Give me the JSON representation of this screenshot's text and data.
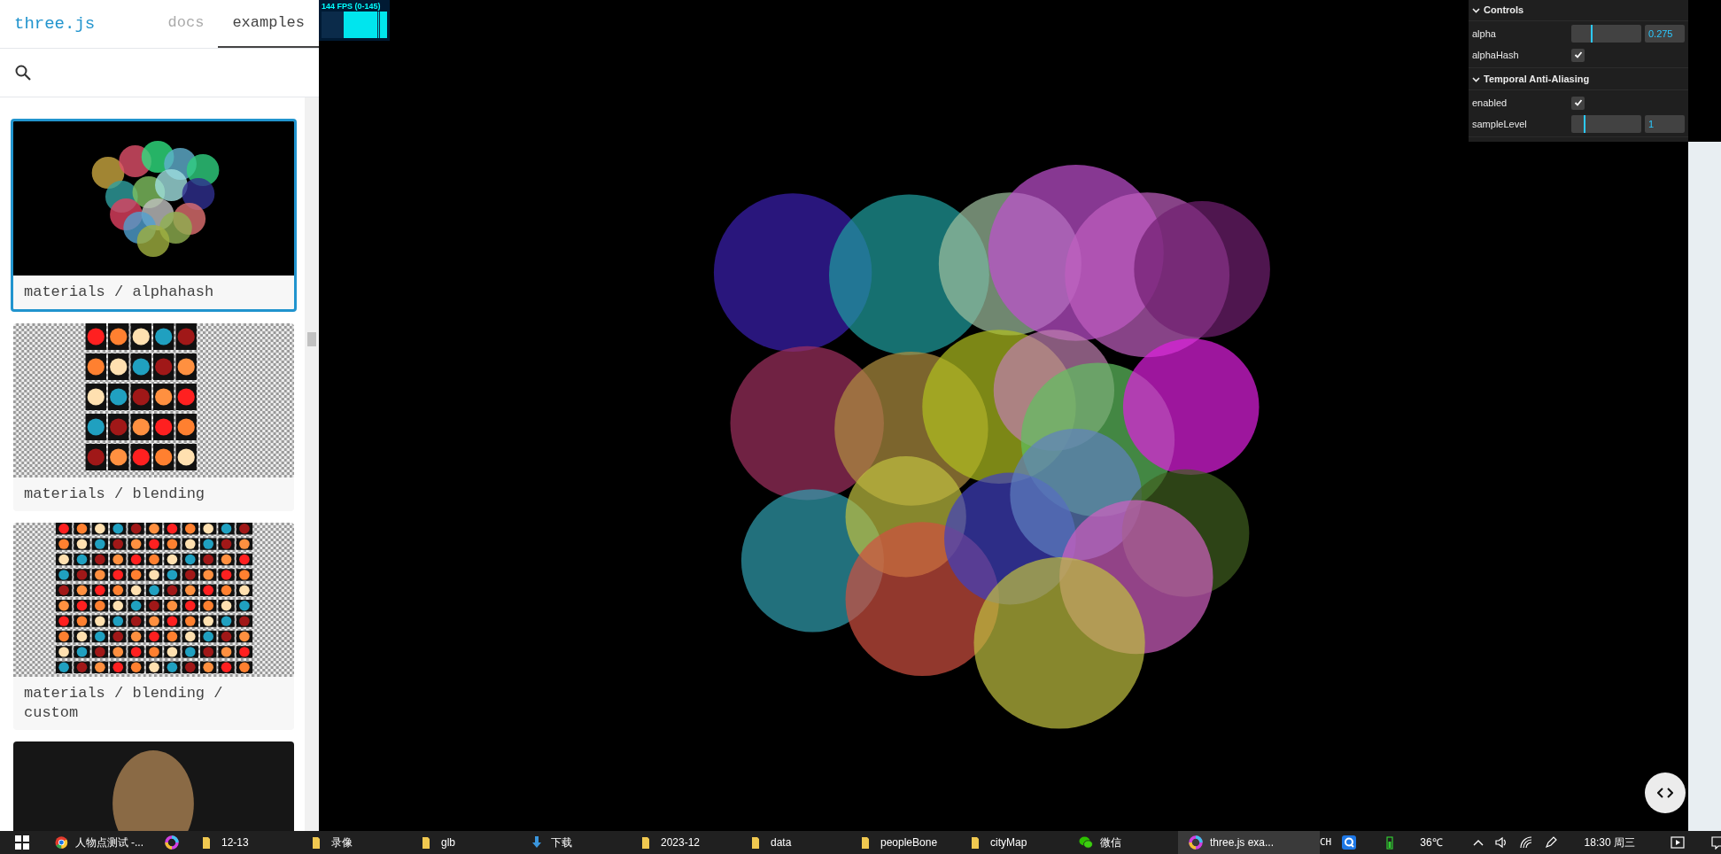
{
  "header": {
    "logo": "three.js",
    "tabs": [
      {
        "label": "docs",
        "selected": false
      },
      {
        "label": "examples",
        "selected": true
      }
    ]
  },
  "examples": [
    {
      "kind": "spheres",
      "title": "materials / alphahash",
      "selected": true
    },
    {
      "kind": "blending",
      "title": "materials / blending",
      "selected": false
    },
    {
      "kind": "blending-custom",
      "title": "materials / blending / custom",
      "selected": false
    },
    {
      "kind": "photo",
      "selected": false
    }
  ],
  "stats": {
    "fps": "144 FPS (0-145)"
  },
  "gui": {
    "folders": [
      {
        "title": "Controls",
        "expanded": true,
        "controls": [
          {
            "kind": "slider",
            "label": "alpha",
            "level": 0.27,
            "value": "0.275"
          },
          {
            "kind": "checkbox",
            "label": "alphaHash",
            "checked": true
          }
        ]
      },
      {
        "title": "Temporal Anti-Aliasing",
        "expanded": true,
        "controls": [
          {
            "kind": "checkbox",
            "label": "enabled",
            "checked": true
          },
          {
            "kind": "slider",
            "label": "sampleLevel",
            "level": 0.17,
            "value": "1"
          }
        ]
      }
    ]
  },
  "taskbar": {
    "items": [
      {
        "kind": "chrome",
        "label": "人物点测试 -...",
        "selected": false
      },
      {
        "kind": "app",
        "selected": false
      },
      {
        "kind": "folder",
        "label": "12-13",
        "selected": false
      },
      {
        "kind": "folder",
        "label": "录像",
        "selected": false
      },
      {
        "kind": "folder",
        "label": "glb",
        "selected": false
      },
      {
        "kind": "download",
        "label": "下载",
        "selected": false
      },
      {
        "kind": "folder",
        "label": "2023-12",
        "selected": false
      },
      {
        "kind": "folder",
        "label": "data",
        "selected": false
      },
      {
        "kind": "folder",
        "label": "peopleBone",
        "selected": false
      },
      {
        "kind": "folder",
        "label": "cityMap",
        "selected": false
      },
      {
        "kind": "wechat",
        "label": "微信",
        "selected": false
      },
      {
        "kind": "app",
        "label": "three.js exa...",
        "selected": true
      }
    ],
    "tray": {
      "language": "CH",
      "temperature": "36℃",
      "clock": "18:30 周三"
    }
  }
}
